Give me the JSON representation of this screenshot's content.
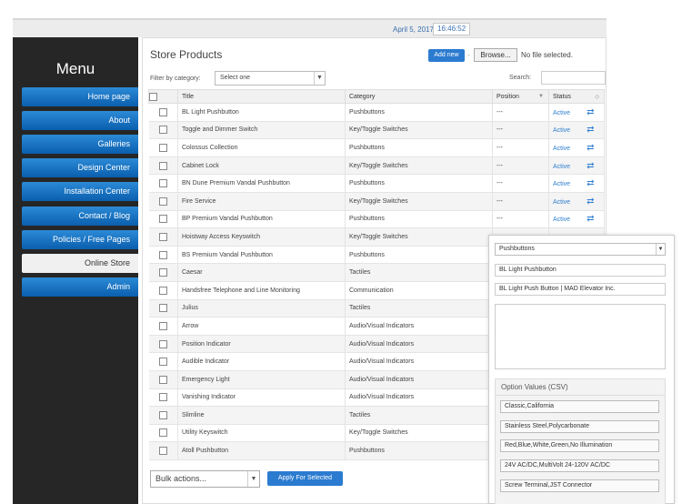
{
  "topbar": {
    "date": "April 5, 2017",
    "time": "16:46:52"
  },
  "sidebar": {
    "title": "Menu",
    "items": [
      {
        "label": "Home page"
      },
      {
        "label": "About"
      },
      {
        "label": "Galleries"
      },
      {
        "label": "Design Center"
      },
      {
        "label": "Installation Center"
      },
      {
        "label": "Contact / Blog"
      },
      {
        "label": "Policies / Free Pages"
      },
      {
        "label": "Online Store",
        "active": true
      },
      {
        "label": "Admin"
      }
    ]
  },
  "main": {
    "title": "Store Products",
    "add_label": "Add new",
    "browse_label": "Browse...",
    "file_label": "No file selected.",
    "filter_label": "Filter by category:",
    "filter_value": "Select one",
    "search_label": "Search:",
    "columns": [
      "Title",
      "Category",
      "Position",
      "Status"
    ],
    "rows": [
      {
        "title": "BL Light Pushbutton",
        "category": "Pushbuttons",
        "position": "---",
        "status": "Active"
      },
      {
        "title": "Toggle and Dimmer Switch",
        "category": "Key/Toggle Switches",
        "position": "---",
        "status": "Active"
      },
      {
        "title": "Colossus Collection",
        "category": "Pushbuttons",
        "position": "---",
        "status": "Active"
      },
      {
        "title": "Cabinet Lock",
        "category": "Key/Toggle Switches",
        "position": "---",
        "status": "Active"
      },
      {
        "title": "BN Dune Premium Vandal Pushbutton",
        "category": "Pushbuttons",
        "position": "---",
        "status": "Active"
      },
      {
        "title": "Fire Service",
        "category": "Key/Toggle Switches",
        "position": "---",
        "status": "Active"
      },
      {
        "title": "BP Premium Vandal Pushbutton",
        "category": "Pushbuttons",
        "position": "---",
        "status": "Active"
      },
      {
        "title": "Hoistway Access Keyswitch",
        "category": "Key/Toggle Switches",
        "position": "",
        "status": ""
      },
      {
        "title": "BS Premium Vandal Pushbutton",
        "category": "Pushbuttons",
        "position": "",
        "status": ""
      },
      {
        "title": "Caesar",
        "category": "Tactiles",
        "position": "",
        "status": ""
      },
      {
        "title": "Handsfree Telephone and Line Monitoring",
        "category": "Communication",
        "position": "",
        "status": ""
      },
      {
        "title": "Julius",
        "category": "Tactiles",
        "position": "",
        "status": ""
      },
      {
        "title": "Arrow",
        "category": "Audio/Visual Indicators",
        "position": "",
        "status": ""
      },
      {
        "title": "Position Indicator",
        "category": "Audio/Visual Indicators",
        "position": "",
        "status": ""
      },
      {
        "title": "Audible Indicator",
        "category": "Audio/Visual Indicators",
        "position": "",
        "status": ""
      },
      {
        "title": "Emergency Light",
        "category": "Audio/Visual Indicators",
        "position": "",
        "status": ""
      },
      {
        "title": "Vanishing Indicator",
        "category": "Audio/Visual Indicators",
        "position": "",
        "status": ""
      },
      {
        "title": "Slimline",
        "category": "Tactiles",
        "position": "",
        "status": ""
      },
      {
        "title": "Utility Keyswitch",
        "category": "Key/Toggle Switches",
        "position": "",
        "status": ""
      },
      {
        "title": "Atoll Pushbutton",
        "category": "Pushbuttons",
        "position": "",
        "status": ""
      }
    ],
    "bulk_label": "Bulk actions...",
    "apply_label": "Apply For Selected"
  },
  "edit_panel": {
    "category_value": "Pushbuttons",
    "name_value": "BL Light Pushbutton",
    "meta_value": "BL Light Push Button | MAD Elevator Inc.",
    "option_title": "Option Values (CSV)",
    "options": [
      "Classic,California",
      "Stainless Steel,Polycarbonate",
      "Red,Blue,White,Green,No Illumination",
      "24V AC/DC,MultiVolt 24-120V AC/DC",
      "Screw Terminal,JST Connector"
    ]
  },
  "colors": {
    "accent": "#2b7bd0",
    "sidebar_bg": "#262626",
    "active_status": "#2e7ecf"
  }
}
